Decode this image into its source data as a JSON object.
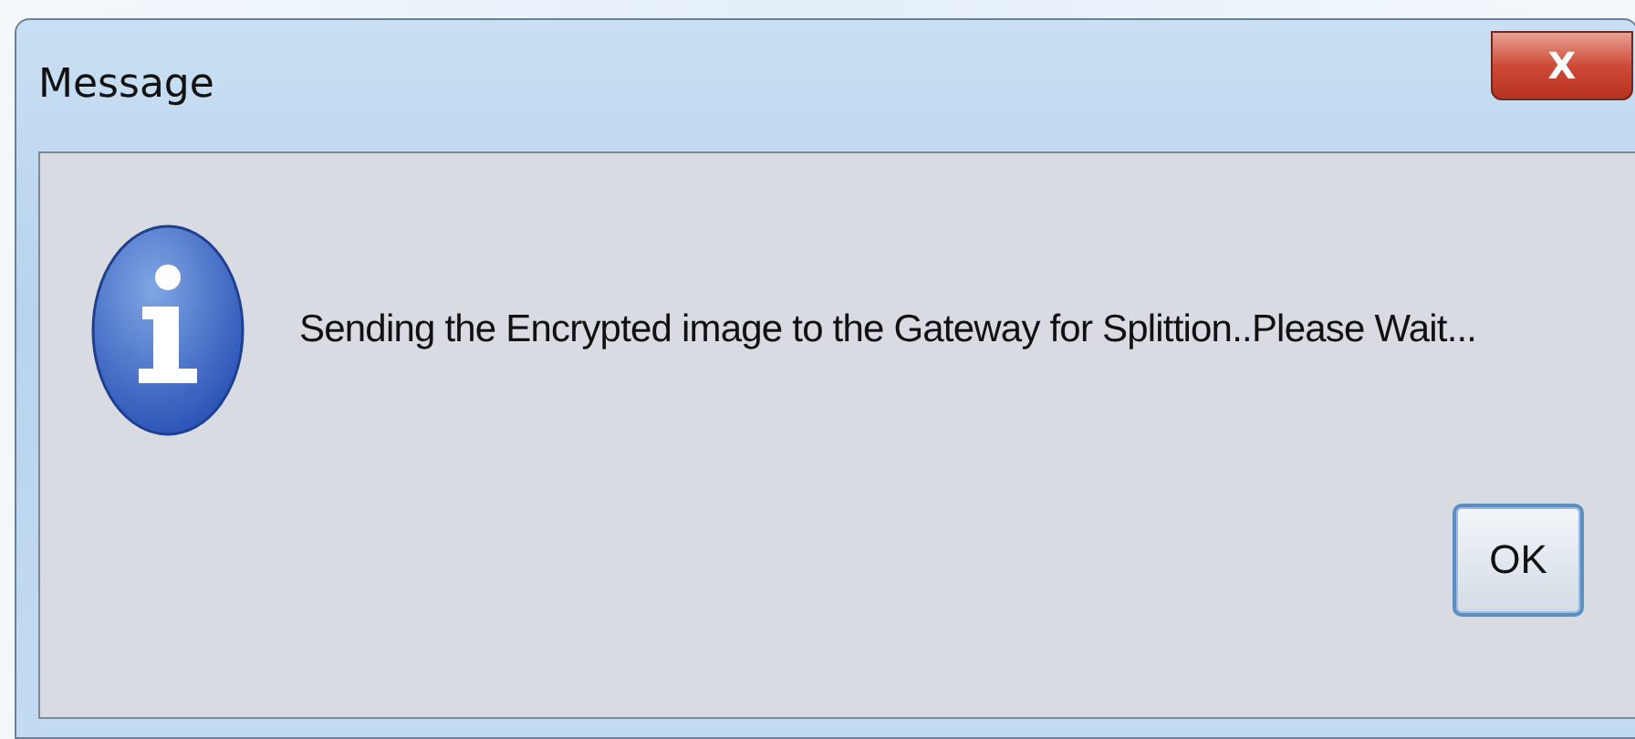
{
  "window": {
    "title": "Message",
    "close_label": "X"
  },
  "message": {
    "kind": "info",
    "text": "Sending the Encrypted image to the Gateway for Splittion..Please Wait..."
  },
  "buttons": [
    "OK"
  ]
}
